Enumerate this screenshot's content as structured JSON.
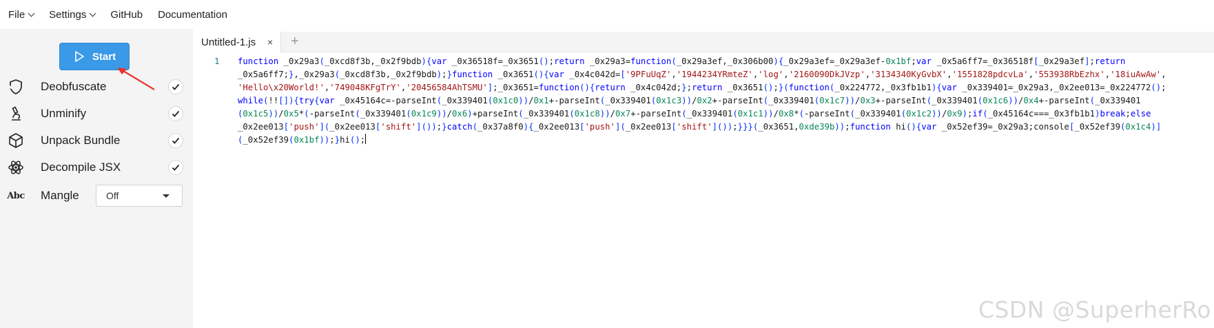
{
  "menu": {
    "file": "File",
    "settings": "Settings",
    "github": "GitHub",
    "documentation": "Documentation"
  },
  "sidebar": {
    "start_label": "Start",
    "options": [
      {
        "label": "Deobfuscate",
        "icon": "shield-icon",
        "checked": true
      },
      {
        "label": "Unminify",
        "icon": "microscope-icon",
        "checked": true
      },
      {
        "label": "Unpack Bundle",
        "icon": "package-icon",
        "checked": true
      },
      {
        "label": "Decompile JSX",
        "icon": "atom-icon",
        "checked": true
      }
    ],
    "mangle": {
      "label": "Mangle",
      "icon_text": "Abc",
      "value": "Off"
    }
  },
  "editor": {
    "tab_title": "Untitled-1.js",
    "tab_close": "×",
    "tab_add": "+",
    "line_number": "1",
    "code_lines": [
      "function _0x29a3(_0xcd8f3b,_0x2f9bdb){var _0x36518f=_0x3651();return _0x29a3=function(_0x29a3ef,_0x306b00){_0x29a3ef=_0x29a3ef-0x1bf;var _0x5a6ff7=_0x36518f[_0x29a3ef];return",
      "_0x5a6ff7;},_0x29a3(_0xcd8f3b,_0x2f9bdb);}function _0x3651(){var _0x4c042d=['9PFuUqZ','1944234YRmteZ','log','2160090DkJVzp','3134340KyGvbX','1551828pdcvLa','553938RbEzhx','18iuAwAw',",
      "'Hello\\x20World!','749048KFgTrY','20456584AhTSMU'];_0x3651=function(){return _0x4c042d;};return _0x3651();}(function(_0x224772,_0x3fb1b1){var _0x339401=_0x29a3,_0x2ee013=_0x224772();",
      "while(!![]){try{var _0x45164c=-parseInt(_0x339401(0x1c0))/0x1+-parseInt(_0x339401(0x1c3))/0x2+-parseInt(_0x339401(0x1c7))/0x3+-parseInt(_0x339401(0x1c6))/0x4+-parseInt(_0x339401",
      "(0x1c5))/0x5*(-parseInt(_0x339401(0x1c9))/0x6)+parseInt(_0x339401(0x1c8))/0x7+-parseInt(_0x339401(0x1c1))/0x8*(-parseInt(_0x339401(0x1c2))/0x9);if(_0x45164c===_0x3fb1b1)break;else",
      "_0x2ee013['push'](_0x2ee013['shift']());}catch(_0x37a8f0){_0x2ee013['push'](_0x2ee013['shift']());}}}(_0x3651,0xde39b));function hi(){var _0x52ef39=_0x29a3;console[_0x52ef39(0x1c4)]",
      "(_0x52ef39(0x1bf));}hi();"
    ]
  },
  "watermark": "CSDN @SuperherRo",
  "colors": {
    "accent": "#3a9ae8",
    "sidebar_bg": "#f4f4f5",
    "annotation_red": "#e8332f"
  }
}
